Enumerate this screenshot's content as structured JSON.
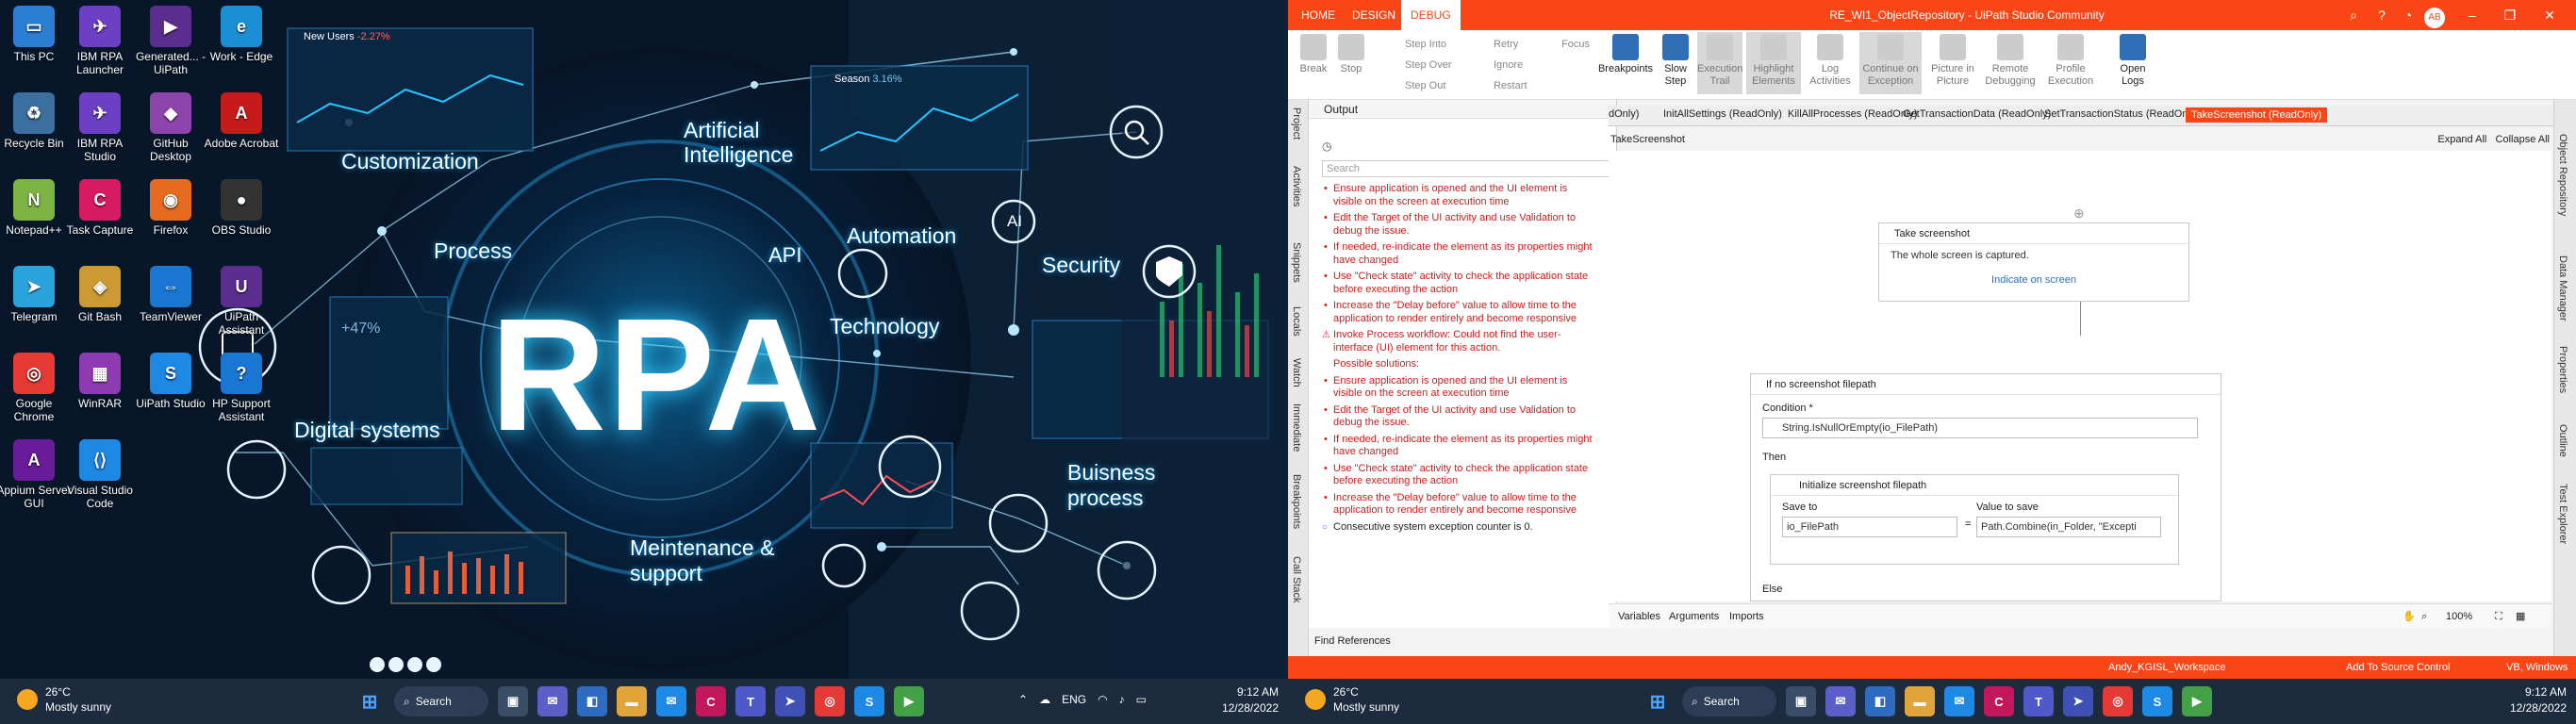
{
  "left_desktop": {
    "icons": [
      {
        "label": "This PC",
        "color": "#2a7fd4",
        "glyph": "▭"
      },
      {
        "label": "IBM RPA Launcher",
        "color": "#6c3fc4",
        "glyph": "✈"
      },
      {
        "label": "Generated... - UiPath",
        "color": "#5b2d8e",
        "glyph": "▶"
      },
      {
        "label": "Work - Edge",
        "color": "#1b8fd6",
        "glyph": "e"
      },
      {
        "label": "Recycle Bin",
        "color": "#3a6fa0",
        "glyph": "♻"
      },
      {
        "label": "IBM RPA Studio",
        "color": "#6c3fc4",
        "glyph": "✈"
      },
      {
        "label": "GitHub Desktop",
        "color": "#8e44ad",
        "glyph": "◆"
      },
      {
        "label": "Adobe Acrobat",
        "color": "#c71a1a",
        "glyph": "A"
      },
      {
        "label": "Notepad++",
        "color": "#7cb342",
        "glyph": "N"
      },
      {
        "label": "Task Capture",
        "color": "#d81b60",
        "glyph": "C"
      },
      {
        "label": "Firefox",
        "color": "#e66a1f",
        "glyph": "◉"
      },
      {
        "label": "OBS Studio",
        "color": "#333",
        "glyph": "●"
      },
      {
        "label": "Telegram",
        "color": "#2aa3dd",
        "glyph": "➤"
      },
      {
        "label": "Git Bash",
        "color": "#c93",
        "glyph": "◈"
      },
      {
        "label": "TeamViewer",
        "color": "#1976d2",
        "glyph": "⇔"
      },
      {
        "label": "UiPath Assistant",
        "color": "#5b2d8e",
        "glyph": "U"
      },
      {
        "label": "Google Chrome",
        "color": "#e53935",
        "glyph": "◎"
      },
      {
        "label": "WinRAR",
        "color": "#8e3bb3",
        "glyph": "▦"
      },
      {
        "label": "UiPath Studio",
        "color": "#1e88e5",
        "glyph": "S"
      },
      {
        "label": "HP Support Assistant",
        "color": "#1976d2",
        "glyph": "?"
      },
      {
        "label": "Appium Server GUI",
        "color": "#6a1b9a",
        "glyph": "A"
      },
      {
        "label": "Visual Studio Code",
        "color": "#1e88e5",
        "glyph": "⟨⟩"
      }
    ],
    "wallpaper": {
      "title": "RPA",
      "labels": [
        "Customization",
        "Process",
        "Artificial Intelligence",
        "API",
        "Automation",
        "Security",
        "Technology",
        "Digital systems",
        "Buisness process",
        "Meintenance & support"
      ],
      "chart_new_users": "New Users",
      "chart_new_users_delta": "-2.27%",
      "chart_season": "Season",
      "chart_season_delta": "3.16%",
      "chart_pct": "+47%",
      "ai_badge": "AI"
    }
  },
  "taskbar": {
    "temperature": "26°C",
    "weather": "Mostly sunny",
    "search_label": "Search",
    "language": "ENG",
    "time": "9:12 AM",
    "date": "12/28/2022"
  },
  "uipath": {
    "menu_tabs": [
      "HOME",
      "DESIGN",
      "DEBUG"
    ],
    "window_title": "RE_WI1_ObjectRepository - UiPath Studio Community",
    "user_initials": "AB",
    "ribbon": {
      "break": "Break",
      "stop": "Stop",
      "step_into": "Step Into",
      "step_over": "Step Over",
      "step_out": "Step Out",
      "retry": "Retry",
      "ignore": "Ignore",
      "restart": "Restart",
      "focus": "Focus",
      "breakpoints": "Breakpoints",
      "slow_step": "Slow Step",
      "execution_trail": "Execution Trail",
      "highlight_elements": "Highlight Elements",
      "log_activities": "Log Activities",
      "continue_on_exception": "Continue on Exception",
      "picture_in_picture": "Picture in Picture",
      "remote_debugging": "Remote Debugging",
      "profile_execution": "Profile Execution",
      "open_logs": "Open Logs"
    },
    "left_strip": [
      "Project",
      "Activities",
      "Snippets",
      "Locals",
      "Watch",
      "Immediate",
      "Breakpoints",
      "Call Stack"
    ],
    "right_strip": [
      "Object Repository",
      "Data Manager",
      "Properties",
      "Outline",
      "Test Explorer"
    ],
    "output": {
      "title": "Output",
      "search_placeholder": "Search",
      "lines": [
        {
          "kind": "bullet",
          "text": "Ensure application is opened and the UI element is visible on the screen at execution time"
        },
        {
          "kind": "bullet",
          "text": "Edit the Target of the UI activity and use Validation to debug the issue."
        },
        {
          "kind": "bullet",
          "text": "If needed, re-indicate the element as its properties might have changed"
        },
        {
          "kind": "bullet",
          "text": "Use \"Check state\" activity to check the application state before executing the action"
        },
        {
          "kind": "bullet",
          "text": "Increase the \"Delay before\" value to allow time to the application to render entirely and become responsive"
        },
        {
          "kind": "warn",
          "text": "Invoke Process workflow: Could not find the user-interface (UI) element for this action."
        },
        {
          "kind": "plain",
          "text": "Possible solutions:"
        },
        {
          "kind": "bullet",
          "text": "Ensure application is opened and the UI element is visible on the screen at execution time"
        },
        {
          "kind": "bullet",
          "text": "Edit the Target of the UI activity and use Validation to debug the issue."
        },
        {
          "kind": "bullet",
          "text": "If needed, re-indicate the element as its properties might have changed"
        },
        {
          "kind": "bullet",
          "text": "Use \"Check state\" activity to check the application state before executing the action"
        },
        {
          "kind": "bullet",
          "text": "Increase the \"Delay before\" value to allow time to the application to render entirely and become responsive"
        },
        {
          "kind": "info",
          "text": "Consecutive system exception counter is 0."
        }
      ],
      "find_references": "Find References"
    },
    "doc_tabs": [
      "dOnly)",
      "InitAllSettings (ReadOnly)",
      "KillAllProcesses (ReadOnly)",
      "GetTransactionData (ReadOnly)",
      "SetTransactionStatus (ReadOnly)",
      "TakeScreenshot (ReadOnly)"
    ],
    "breadcrumb": "TakeScreenshot",
    "expand_all": "Expand All",
    "collapse_all": "Collapse All",
    "take_screenshot": {
      "title": "Take screenshot",
      "desc": "The whole screen is captured.",
      "link": "Indicate on screen"
    },
    "if_activity": {
      "title": "If no screenshot filepath",
      "condition_label": "Condition *",
      "condition_value": "String.IsNullOrEmpty(io_FilePath)",
      "then_label": "Then",
      "else_label": "Else"
    },
    "assign_activity": {
      "title": "Initialize screenshot filepath",
      "save_to_label": "Save to",
      "save_to_value": "io_FilePath",
      "value_label": "Value to save",
      "value_value": "Path.Combine(in_Folder, \"Excepti"
    },
    "bottom_tabs": [
      "Variables",
      "Arguments",
      "Imports"
    ],
    "zoom": "100%",
    "status": {
      "workspace": "Andy_KGISL_Workspace",
      "source_control": "Add To Source Control",
      "language": "VB, Windows"
    }
  }
}
